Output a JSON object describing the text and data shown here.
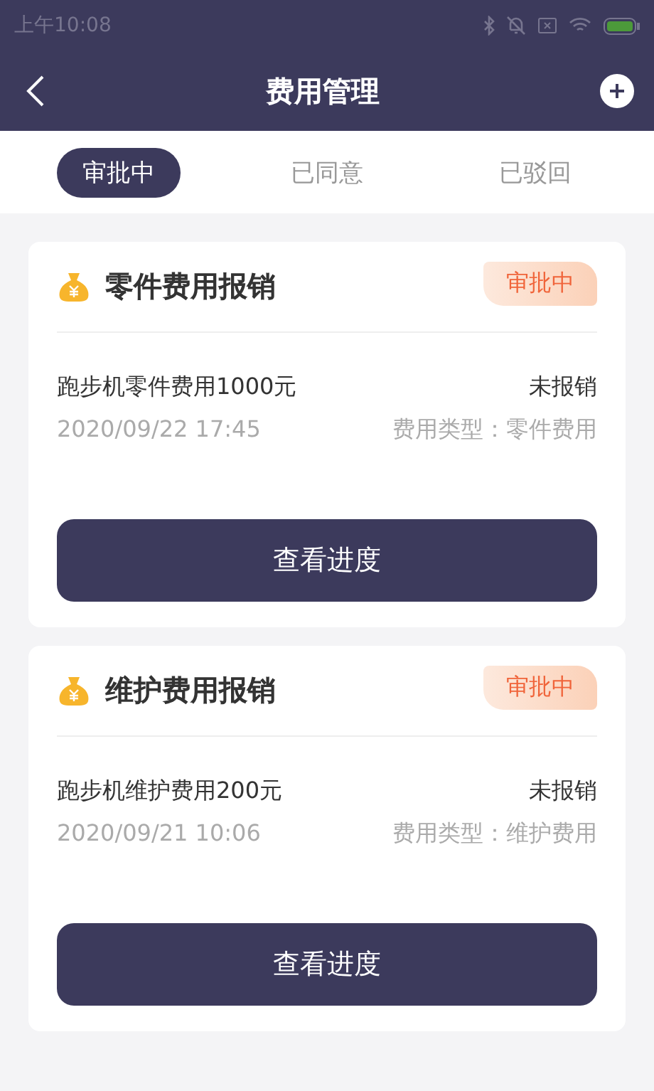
{
  "status_bar": {
    "time": "上午10:08"
  },
  "header": {
    "title": "费用管理"
  },
  "tabs": [
    {
      "label": "审批中",
      "selected": true
    },
    {
      "label": "已同意",
      "selected": false
    },
    {
      "label": "已驳回",
      "selected": false
    }
  ],
  "cards": [
    {
      "title": "零件费用报销",
      "status": "审批中",
      "item": "跑步机零件费用1000元",
      "reimbursement": "未报销",
      "date": "2020/09/22 17:45",
      "type": "费用类型：零件费用",
      "button": "查看进度"
    },
    {
      "title": "维护费用报销",
      "status": "审批中",
      "item": "跑步机维护费用200元",
      "reimbursement": "未报销",
      "date": "2020/09/21 10:06",
      "type": "费用类型：维护费用",
      "button": "查看进度"
    }
  ]
}
